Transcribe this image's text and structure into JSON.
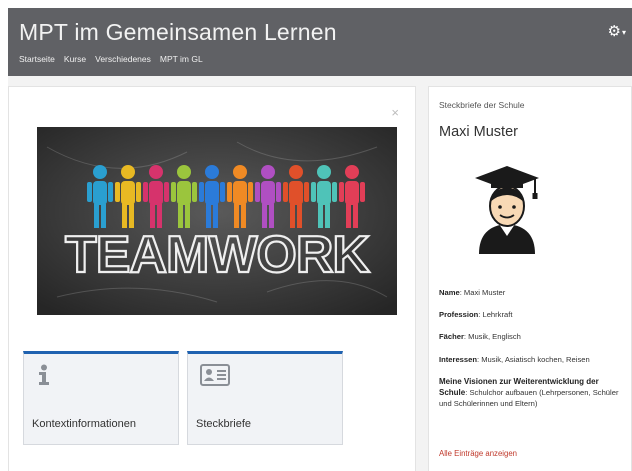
{
  "header": {
    "title": "MPT im Gemeinsamen Lernen",
    "nav": [
      "Startseite",
      "Kurse",
      "Verschiedenes",
      "MPT im GL"
    ],
    "settings_icon": "gear-icon",
    "settings_caret": "▾"
  },
  "left": {
    "close_symbol": "×",
    "banner_text": "TEAMWORK",
    "tiles": [
      {
        "label": "Kontextinformationen",
        "icon": "info-icon"
      },
      {
        "label": "Steckbriefe",
        "icon": "id-card-icon"
      }
    ]
  },
  "right": {
    "heading": "Steckbriefe der Schule",
    "name": "Maxi Muster",
    "fields": {
      "name_label": "Name",
      "name_value": ": Maxi Muster",
      "prof_label": "Profession",
      "prof_value": ": Lehrkraft",
      "faecher_label": "Fächer",
      "faecher_value": ": Musik, Englisch",
      "int_label": "Interessen",
      "int_value": ": Musik, Asiatisch kochen, Reisen",
      "vision_label": "Meine Visionen zur Weiterentwicklung der Schule",
      "vision_value": ": Schulchor aufbauen (Lehrpersonen, Schüler und Schülerinnen und Eltern)"
    },
    "all_link": "Alle Einträge anzeigen"
  },
  "colors": {
    "header_bg": "#606165",
    "tile_accent": "#1f62b0",
    "link_red": "#c0392b"
  }
}
